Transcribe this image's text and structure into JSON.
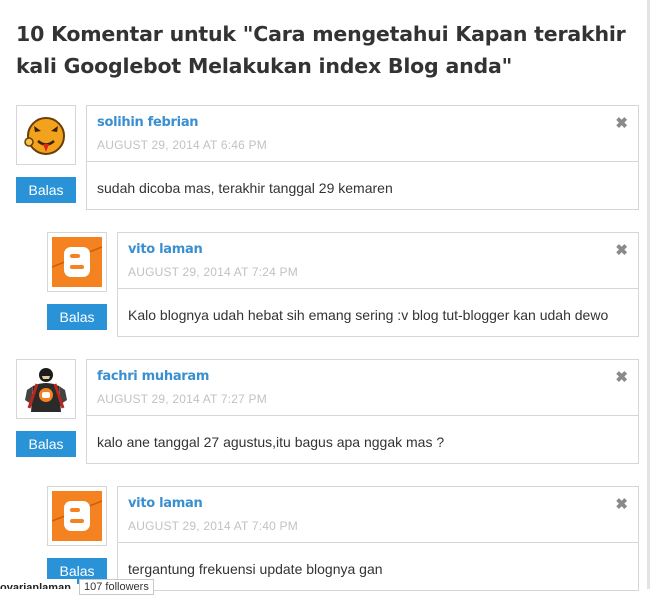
{
  "title": "10 Komentar untuk \"Cara mengetahui Kapan terakhir kali Googlebot Melakukan index Blog anda\"",
  "comments": [
    {
      "author": "solihin febrian",
      "date": "AUGUST 29, 2014 AT 6:46 PM",
      "text": "sudah dicoba mas, terakhir tanggal 29 kemaren",
      "reply_label": "Balas",
      "close_label": "✖",
      "avatar": "orange-face-avatar-icon"
    },
    {
      "author": "vito laman",
      "date": "AUGUST 29, 2014 AT 7:24 PM",
      "text": "Kalo blognya udah hebat sih emang sering :v blog tut-blogger kan udah dewo",
      "reply_label": "Balas",
      "close_label": "✖",
      "avatar": "blogger-logo-avatar-icon"
    },
    {
      "author": "fachri muharam",
      "date": "AUGUST 29, 2014 AT 7:27 PM",
      "text": "kalo ane tanggal 27 agustus,itu bagus apa nggak mas ?",
      "reply_label": "Balas",
      "close_label": "✖",
      "avatar": "blogger-hero-avatar-icon"
    },
    {
      "author": "vito laman",
      "date": "AUGUST 29, 2014 AT 7:40 PM",
      "text": "tergantung frekuensi update blognya gan",
      "reply_label": "Balas",
      "close_label": "✖",
      "avatar": "blogger-logo-avatar-icon"
    }
  ],
  "follow_bar": {
    "user": "ovarianlaman",
    "followers": "107 followers"
  },
  "colors": {
    "accent": "#2a92d6",
    "author": "#3a8fd0",
    "date": "#c2c2c2",
    "border": "#d6d6d6"
  }
}
